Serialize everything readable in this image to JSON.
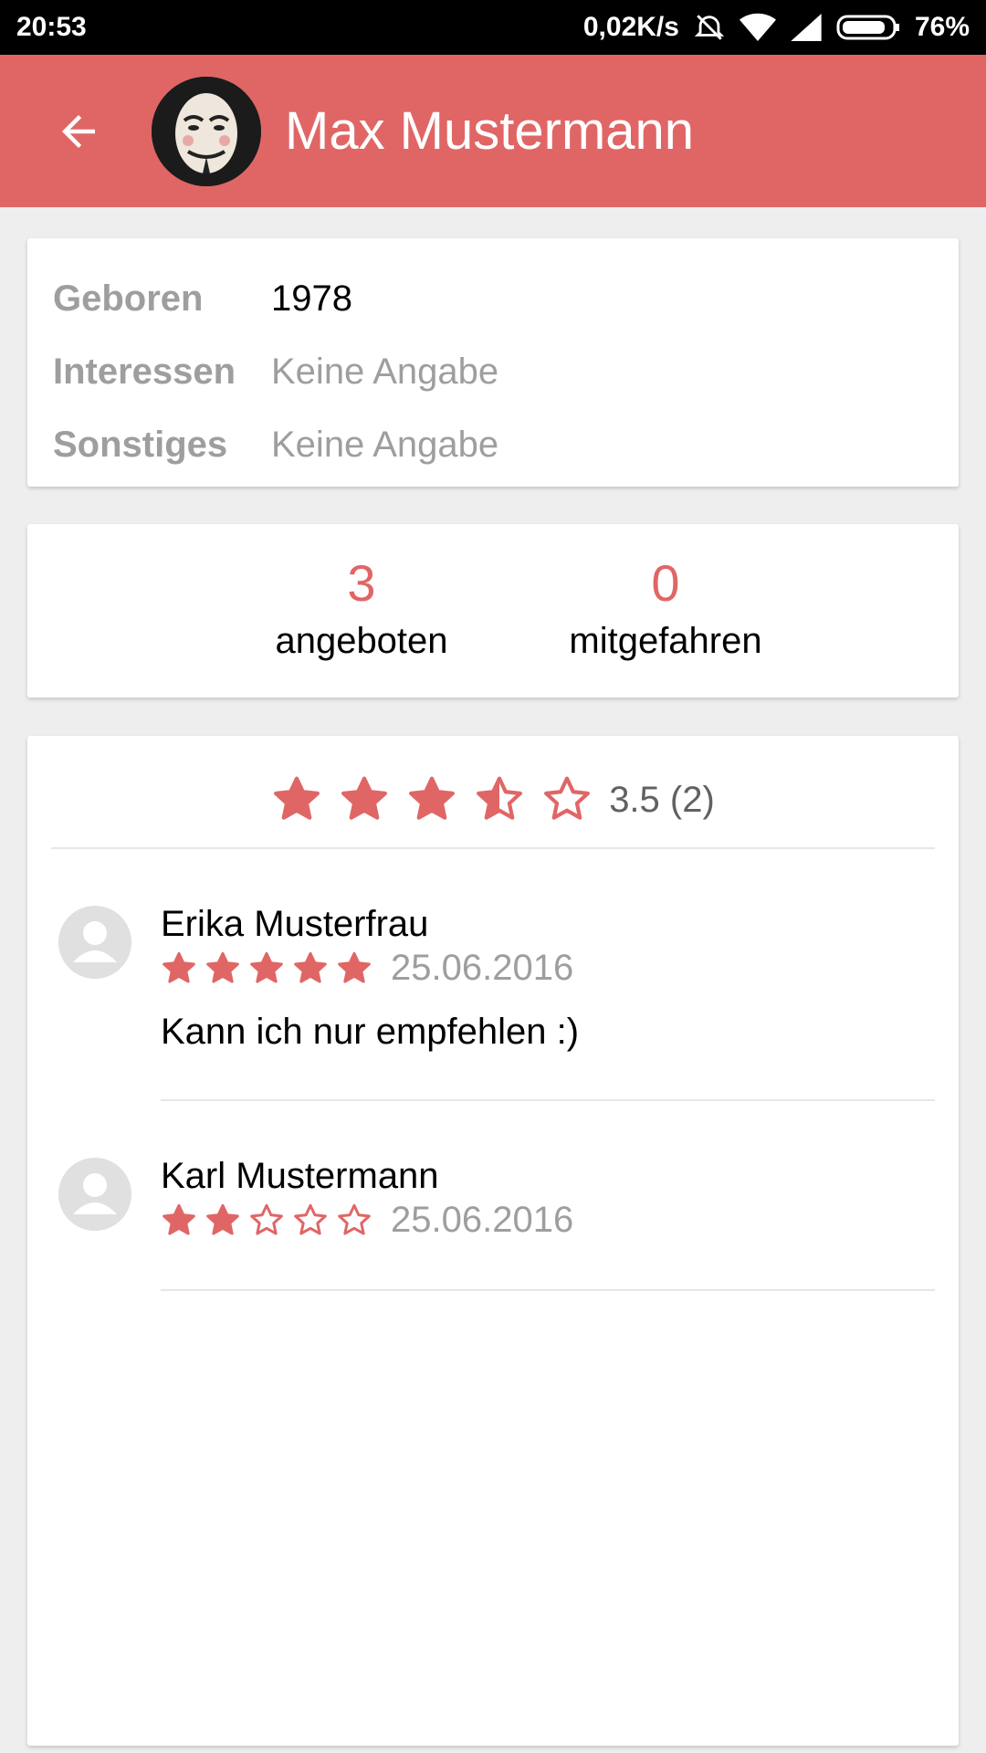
{
  "status_bar": {
    "time": "20:53",
    "net_speed": "0,02K/s",
    "battery": "76%"
  },
  "header": {
    "title": "Max Mustermann",
    "back_icon": "arrow-back-icon",
    "avatar": "profile-avatar",
    "color": "#e06666"
  },
  "info": {
    "rows": [
      {
        "label": "Geboren",
        "value": "1978"
      },
      {
        "label": "Interessen",
        "value": "Keine Angabe"
      },
      {
        "label": "Sonstiges",
        "value": "Keine Angabe"
      }
    ]
  },
  "stats": {
    "offered": {
      "value": "3",
      "label": "angeboten"
    },
    "joined": {
      "value": "0",
      "label": "mitgefahren"
    }
  },
  "rating": {
    "score": 3.5,
    "text": "3.5 (2)"
  },
  "reviews": [
    {
      "name": "Erika Musterfrau",
      "stars": 5,
      "date": "25.06.2016",
      "text": "Kann ich nur empfehlen :)"
    },
    {
      "name": "Karl Mustermann",
      "stars": 2,
      "date": "25.06.2016",
      "text": ""
    }
  ],
  "colors": {
    "accent": "#e06666",
    "muted_text": "#9e9e9e"
  }
}
